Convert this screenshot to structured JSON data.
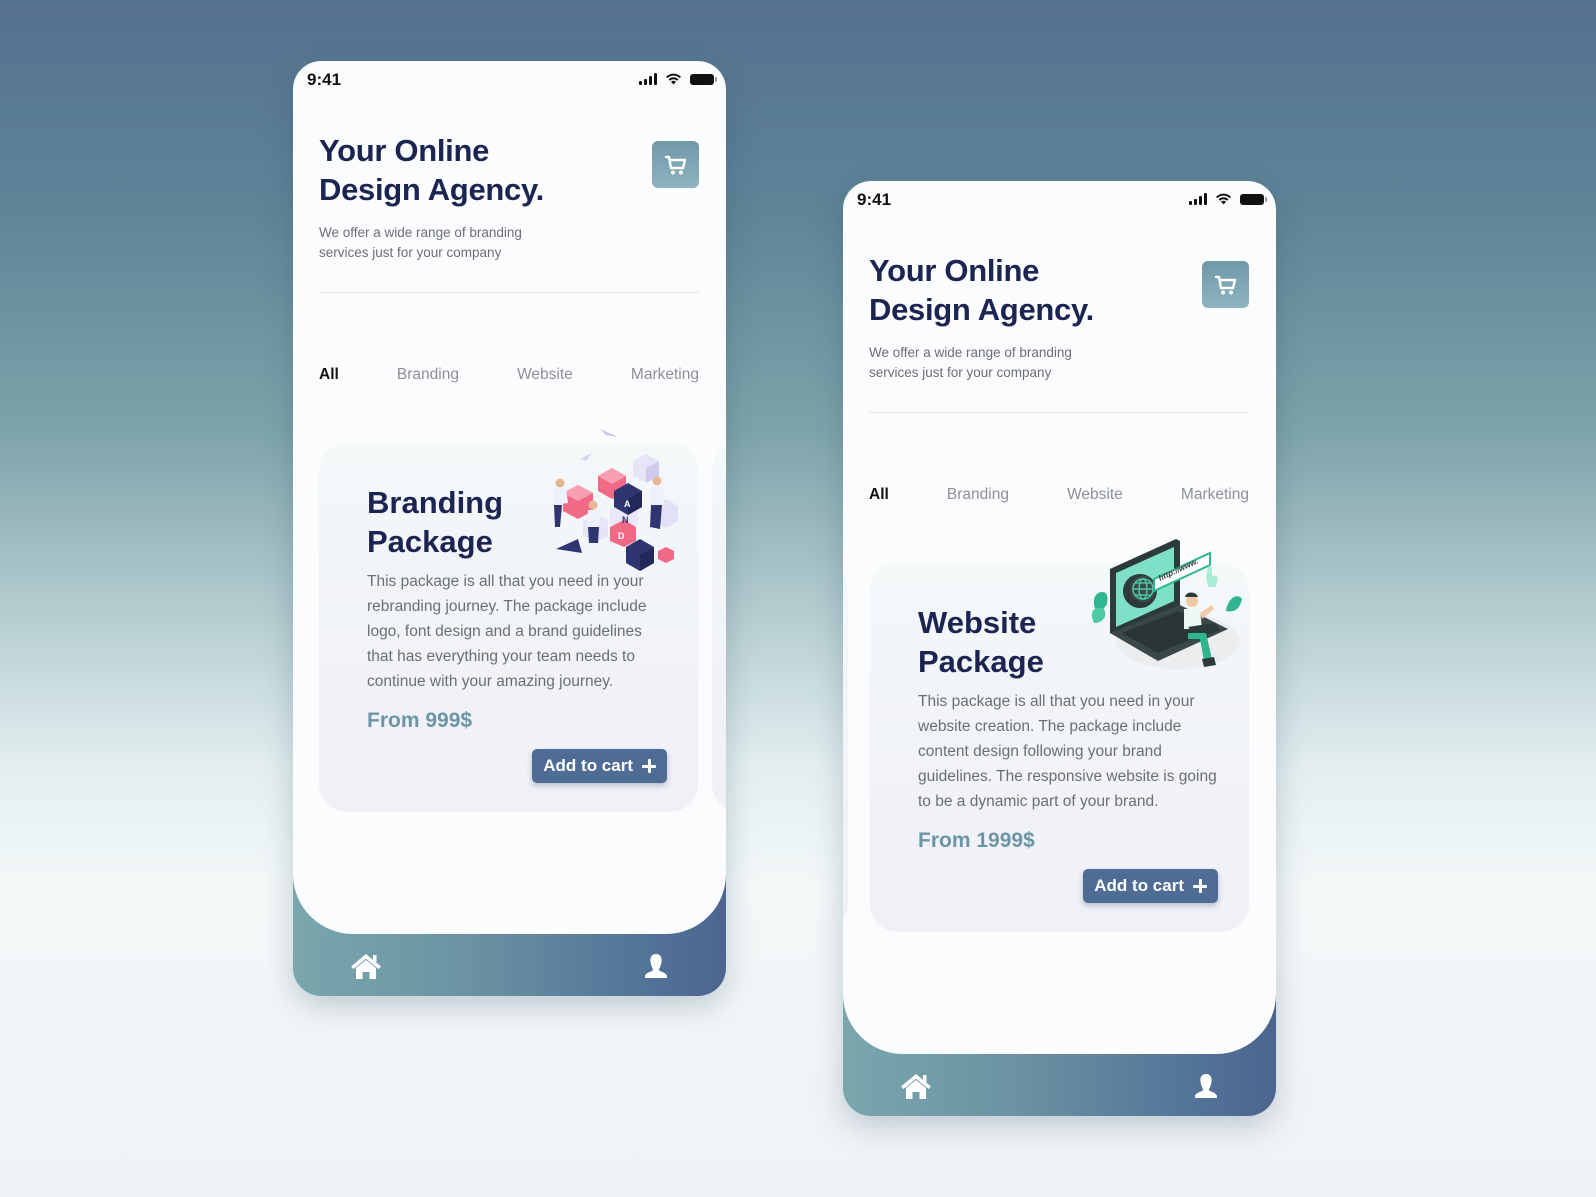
{
  "theme": {
    "headline_color": "#1c2452",
    "price_color": "#6c96a5",
    "button_color": "#4f6d94",
    "cart_button_color": "#7ca2b1",
    "nav_gradient": [
      "#7aa6ad",
      "#4b6590"
    ]
  },
  "screens": [
    {
      "status": {
        "time": "9:41",
        "icons": [
          "signal-icon",
          "wifi-icon",
          "battery-icon"
        ]
      },
      "header": {
        "title_line1": "Your Online",
        "title_line2": "Design Agency.",
        "subtitle_line1": "We offer a wide range of branding",
        "subtitle_line2": "services just for your company",
        "cart_icon": "cart-icon"
      },
      "tabs": [
        {
          "label": "All",
          "active": true
        },
        {
          "label": "Branding",
          "active": false
        },
        {
          "label": "Website",
          "active": false
        },
        {
          "label": "Marketing",
          "active": false
        }
      ],
      "card": {
        "title_line1": "Branding",
        "title_line2": "Package",
        "description": "This package is all that you need in your rebranding journey. The package include logo, font design and a brand guidelines that has everything your team needs to continue with your amazing journey.",
        "price": "From 999$",
        "button_label": "Add to cart",
        "illustration": "brand-blocks-illustration"
      },
      "nav": {
        "home_icon": "home-icon",
        "profile_icon": "profile-icon"
      }
    },
    {
      "status": {
        "time": "9:41",
        "icons": [
          "signal-icon",
          "wifi-icon",
          "battery-icon"
        ]
      },
      "header": {
        "title_line1": "Your Online",
        "title_line2": "Design Agency.",
        "subtitle_line1": "We offer a wide range of branding",
        "subtitle_line2": "services just for your company",
        "cart_icon": "cart-icon"
      },
      "tabs": [
        {
          "label": "All",
          "active": true
        },
        {
          "label": "Branding",
          "active": false
        },
        {
          "label": "Website",
          "active": false
        },
        {
          "label": "Marketing",
          "active": false
        }
      ],
      "card": {
        "title_line1": "Website",
        "title_line2": "Package",
        "description": "This package is all that you need in your website creation. The package include content design following your brand guidelines. The responsive website is going to be a dynamic part of your brand.",
        "price": "From 1999$",
        "button_label": "Add to cart",
        "illustration": "laptop-website-illustration",
        "url_text": "http://www."
      },
      "nav": {
        "home_icon": "home-icon",
        "profile_icon": "profile-icon"
      }
    }
  ]
}
